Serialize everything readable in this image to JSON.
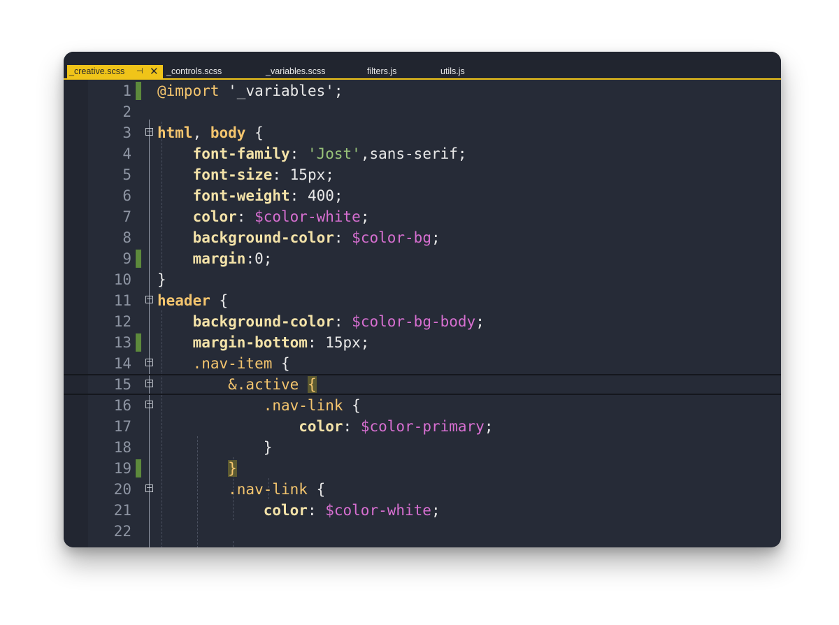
{
  "tabs": [
    {
      "label": "_creative.scss",
      "active": true,
      "pin_icon": "pin-icon",
      "close_icon": "close-icon"
    },
    {
      "label": "_controls.scss",
      "active": false
    },
    {
      "label": "_variables.scss",
      "active": false
    },
    {
      "label": "filters.js",
      "active": false
    },
    {
      "label": "utils.js",
      "active": false
    }
  ],
  "colors": {
    "accent": "#f0c419",
    "editor_bg": "#262b37",
    "selector": "#f4c56e",
    "property": "#f3e2a8",
    "variable": "#d76fd1",
    "string": "#98c379",
    "changed_marker": "#5d8a3c"
  },
  "lines": [
    {
      "n": "1",
      "tokens": [
        [
          "@import",
          "k-import"
        ],
        [
          " '_variables'",
          "k-punct"
        ],
        [
          ";",
          "k-punct"
        ]
      ]
    },
    {
      "n": "2",
      "tokens": []
    },
    {
      "n": "3",
      "tokens": [
        [
          "html",
          "k-sel"
        ],
        [
          ", ",
          "k-punct"
        ],
        [
          "body",
          "k-sel"
        ],
        [
          " {",
          "k-punct"
        ]
      ]
    },
    {
      "n": "4",
      "tokens": [
        [
          "    font-family",
          "k-prop"
        ],
        [
          ": ",
          "k-punct"
        ],
        [
          "'Jost'",
          "k-str"
        ],
        [
          ",sans-serif;",
          "k-punct"
        ]
      ]
    },
    {
      "n": "5",
      "tokens": [
        [
          "    font-size",
          "k-prop"
        ],
        [
          ": 15px;",
          "k-punct"
        ]
      ]
    },
    {
      "n": "6",
      "tokens": [
        [
          "    font-weight",
          "k-prop"
        ],
        [
          ": 400;",
          "k-punct"
        ]
      ]
    },
    {
      "n": "7",
      "tokens": [
        [
          "    color",
          "k-prop"
        ],
        [
          ": ",
          "k-punct"
        ],
        [
          "$color-white",
          "k-var"
        ],
        [
          ";",
          "k-punct"
        ]
      ]
    },
    {
      "n": "8",
      "tokens": [
        [
          "    background-color",
          "k-prop"
        ],
        [
          ": ",
          "k-punct"
        ],
        [
          "$color-bg",
          "k-var"
        ],
        [
          ";",
          "k-punct"
        ]
      ]
    },
    {
      "n": "9",
      "tokens": [
        [
          "    margin",
          "k-prop"
        ],
        [
          ":0;",
          "k-punct"
        ]
      ]
    },
    {
      "n": "10",
      "tokens": [
        [
          "}",
          "k-punct"
        ]
      ]
    },
    {
      "n": "11",
      "tokens": [
        [
          "header",
          "k-sel"
        ],
        [
          " {",
          "k-punct"
        ]
      ]
    },
    {
      "n": "12",
      "tokens": [
        [
          "    background-color",
          "k-prop"
        ],
        [
          ": ",
          "k-punct"
        ],
        [
          "$color-bg-body",
          "k-var"
        ],
        [
          ";",
          "k-punct"
        ]
      ]
    },
    {
      "n": "13",
      "tokens": [
        [
          "    margin-bottom",
          "k-prop"
        ],
        [
          ": 15px;",
          "k-punct"
        ]
      ]
    },
    {
      "n": "14",
      "tokens": [
        [
          "    .nav-item",
          "k-nest"
        ],
        [
          " {",
          "k-punct"
        ]
      ]
    },
    {
      "n": "15",
      "tokens": [
        [
          "        &.active",
          "k-nest"
        ],
        [
          " ",
          "k-punct"
        ],
        [
          "{",
          "bracket-hl"
        ]
      ]
    },
    {
      "n": "16",
      "tokens": [
        [
          "            .nav-link",
          "k-nest"
        ],
        [
          " {",
          "k-punct"
        ]
      ]
    },
    {
      "n": "17",
      "tokens": [
        [
          "                color",
          "k-prop"
        ],
        [
          ": ",
          "k-punct"
        ],
        [
          "$color-primary",
          "k-var"
        ],
        [
          ";",
          "k-punct"
        ]
      ]
    },
    {
      "n": "18",
      "tokens": [
        [
          "            }",
          "k-punct"
        ]
      ]
    },
    {
      "n": "19",
      "tokens": [
        [
          "        ",
          "k-punct"
        ],
        [
          "}",
          "bracket-hl"
        ]
      ]
    },
    {
      "n": "20",
      "tokens": [
        [
          "        .nav-link",
          "k-nest"
        ],
        [
          " {",
          "k-punct"
        ]
      ]
    },
    {
      "n": "21",
      "tokens": [
        [
          "            color",
          "k-prop"
        ],
        [
          ": ",
          "k-punct"
        ],
        [
          "$color-white",
          "k-var"
        ],
        [
          ";",
          "k-punct"
        ]
      ]
    },
    {
      "n": "22",
      "tokens": []
    }
  ],
  "changed_lines": [
    "1",
    "9",
    "13",
    "19"
  ],
  "fold_lines": [
    "3",
    "11",
    "14",
    "15",
    "16",
    "20"
  ],
  "current_line": "15"
}
